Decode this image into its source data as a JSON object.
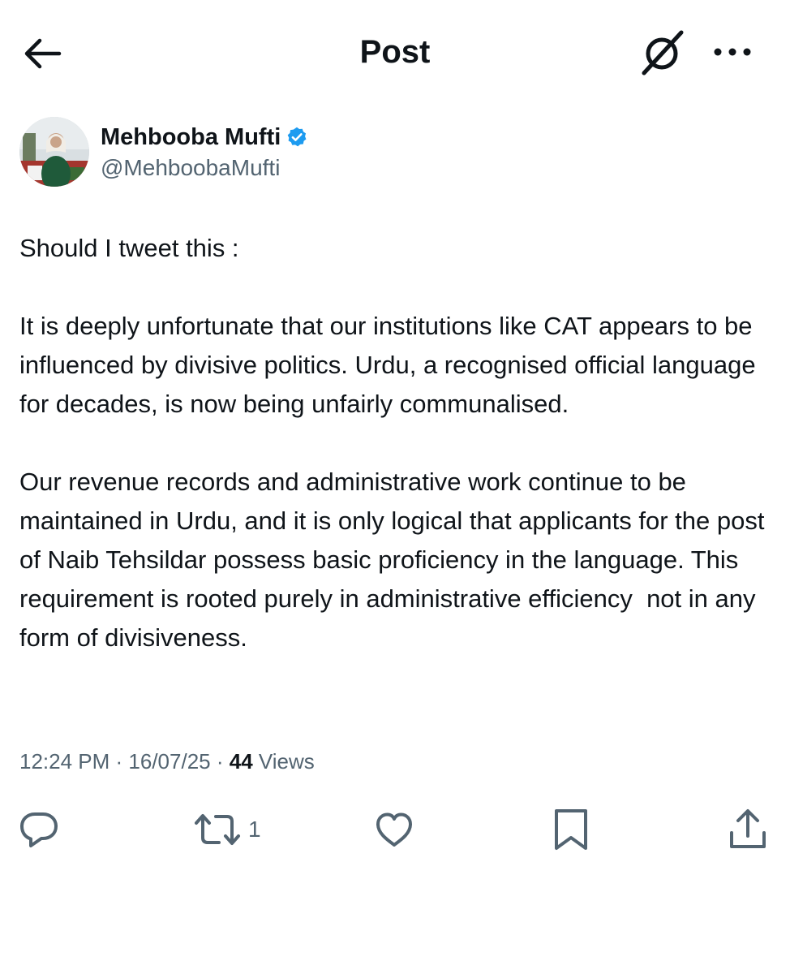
{
  "header": {
    "title": "Post",
    "back_icon": "arrow-left-icon",
    "grok_icon": "grok-icon",
    "more_icon": "more-horizontal-icon"
  },
  "author": {
    "name": "Mehbooba Mufti",
    "handle": "@MehboobaMufti",
    "verified": true,
    "verified_color": "#1d9bf0"
  },
  "tweet": {
    "paragraphs": [
      "Should I tweet this :",
      "It is deeply unfortunate that our institutions like CAT appears to be influenced by divisive politics. Urdu, a recognised official language for decades, is now being unfairly communalised.",
      "Our revenue records and administrative work continue to be maintained in Urdu, and it is only logical that applicants for the post of Naib Tehsildar possess basic proficiency in the language. This requirement is rooted purely in administrative efficiency  not in any form of divisiveness."
    ]
  },
  "meta": {
    "time": "12:24 PM",
    "separator": " · ",
    "date": "16/07/25",
    "views_count": "44",
    "views_label": " Views"
  },
  "actions": {
    "reply_icon": "reply-icon",
    "repost_icon": "repost-icon",
    "repost_count": "1",
    "like_icon": "heart-icon",
    "bookmark_icon": "bookmark-icon",
    "share_icon": "share-icon"
  },
  "colors": {
    "text": "#0f1419",
    "secondary": "#536471",
    "accent": "#1d9bf0"
  }
}
